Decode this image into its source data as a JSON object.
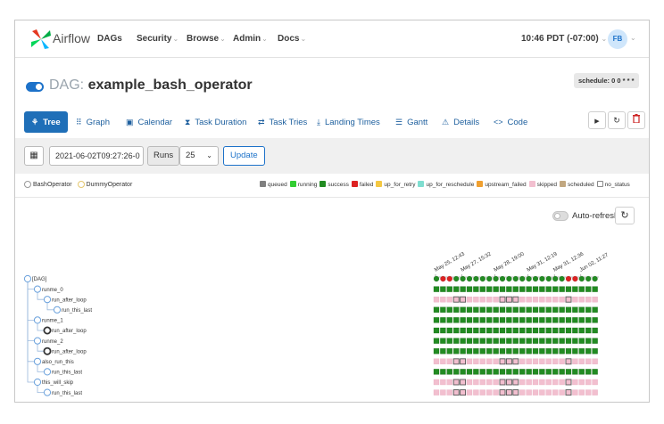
{
  "nav": {
    "brand": "Airflow",
    "items": [
      {
        "label": "DAGs",
        "dropdown": false
      },
      {
        "label": "Security",
        "dropdown": true
      },
      {
        "label": "Browse",
        "dropdown": true
      },
      {
        "label": "Admin",
        "dropdown": true
      },
      {
        "label": "Docs",
        "dropdown": true
      }
    ],
    "clock": "10:46 PDT (-07:00)",
    "avatar": "FB"
  },
  "dag": {
    "prefix": "DAG:",
    "name": "example_bash_operator",
    "schedule": "schedule: 0 0 * * *"
  },
  "tabs": [
    {
      "label": "Tree",
      "icon": "tree-icon",
      "glyph": "⚘"
    },
    {
      "label": "Graph",
      "icon": "graph-icon",
      "glyph": "⠿"
    },
    {
      "label": "Calendar",
      "icon": "calendar-icon",
      "glyph": "▣"
    },
    {
      "label": "Task Duration",
      "icon": "hourglass-icon",
      "glyph": "⧗"
    },
    {
      "label": "Task Tries",
      "icon": "retry-icon",
      "glyph": "⇄"
    },
    {
      "label": "Landing Times",
      "icon": "landing-icon",
      "glyph": "⤓"
    },
    {
      "label": "Gantt",
      "icon": "gantt-icon",
      "glyph": "☰"
    },
    {
      "label": "Details",
      "icon": "warning-icon",
      "glyph": "⚠"
    },
    {
      "label": "Code",
      "icon": "code-icon",
      "glyph": "<>"
    }
  ],
  "actions": {
    "run": "▶",
    "refresh": "↻",
    "delete": "🗑"
  },
  "filter": {
    "date_value": "2021-06-02T09:27:26-0",
    "runs_label": "Runs",
    "runs_value": "25",
    "update_label": "Update"
  },
  "operator_legend": [
    "BashOperator",
    "DummyOperator"
  ],
  "state_legend": [
    {
      "label": "queued",
      "color": "#808080"
    },
    {
      "label": "running",
      "color": "#32cd32"
    },
    {
      "label": "success",
      "color": "#228b22"
    },
    {
      "label": "failed",
      "color": "#dd2222"
    },
    {
      "label": "up_for_retry",
      "color": "#f4c842"
    },
    {
      "label": "up_for_reschedule",
      "color": "#7fded0"
    },
    {
      "label": "upstream_failed",
      "color": "#f0a030"
    },
    {
      "label": "skipped",
      "color": "#f2bfcf"
    },
    {
      "label": "scheduled",
      "color": "#c1a780"
    },
    {
      "label": "no_status",
      "color": "#ffffff"
    }
  ],
  "auto_refresh_label": "Auto-refresh",
  "tree": {
    "nodes": [
      {
        "label": "[DAG]",
        "depth": 0,
        "bold_circle": false
      },
      {
        "label": "runme_0",
        "depth": 1,
        "bold_circle": false
      },
      {
        "label": "run_after_loop",
        "depth": 2,
        "bold_circle": false
      },
      {
        "label": "run_this_last",
        "depth": 3,
        "bold_circle": false
      },
      {
        "label": "runme_1",
        "depth": 1,
        "bold_circle": false
      },
      {
        "label": "run_after_loop",
        "depth": 2,
        "bold_circle": true
      },
      {
        "label": "runme_2",
        "depth": 1,
        "bold_circle": false
      },
      {
        "label": "run_after_loop",
        "depth": 2,
        "bold_circle": true
      },
      {
        "label": "also_run_this",
        "depth": 1,
        "bold_circle": false
      },
      {
        "label": "run_this_last",
        "depth": 2,
        "bold_circle": false
      },
      {
        "label": "this_will_skip",
        "depth": 1,
        "bold_circle": false
      },
      {
        "label": "run_this_last",
        "depth": 2,
        "bold_circle": false
      }
    ],
    "date_labels": [
      "May 25, 12:43",
      "May 27, 15:32",
      "May 28, 19:00",
      "May 31, 12:19",
      "May 31, 12:36",
      "Jun 02, 11:27"
    ],
    "dag_run_states": [
      "success",
      "failed",
      "failed",
      "success",
      "success",
      "success",
      "success",
      "success",
      "success",
      "success",
      "success",
      "success",
      "success",
      "success",
      "success",
      "success",
      "success",
      "success",
      "success",
      "success",
      "failed",
      "failed",
      "success",
      "success",
      "success"
    ],
    "task_rows": [
      "success",
      "skipped-mixed",
      "success",
      "success",
      "success",
      "success",
      "success",
      "skipped-mixed",
      "success",
      "skipped-mixed",
      "skipped-mixed"
    ]
  }
}
